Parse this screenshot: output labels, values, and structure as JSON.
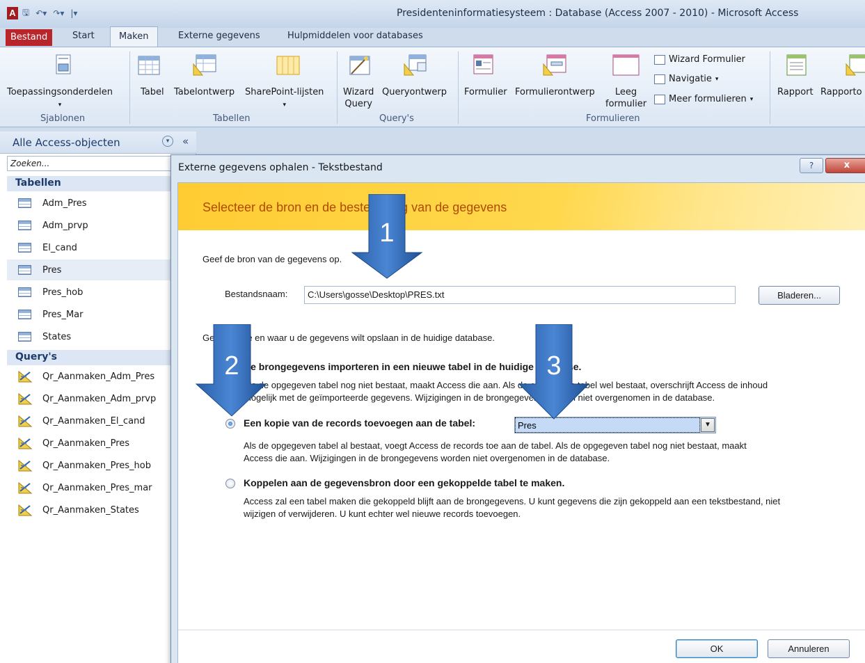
{
  "window": {
    "app_icon": "A",
    "title": "Presidenteninformatiesysteem : Database (Access 2007 - 2010)  -  Microsoft Access",
    "qat_icons": [
      "save-icon",
      "undo-icon",
      "redo-icon",
      "customize-qat-icon"
    ]
  },
  "ribbon": {
    "tabs": {
      "bestand": "Bestand",
      "start": "Start",
      "maken": "Maken",
      "externe": "Externe gegevens",
      "hulpmiddelen": "Hulpmiddelen voor databases"
    },
    "groups": {
      "sjablonen": {
        "label": "Sjablonen",
        "toepassingsonderdelen": "Toepassingsonderdelen"
      },
      "tabellen": {
        "label": "Tabellen",
        "tabel": "Tabel",
        "tabelontwerp": "Tabelontwerp",
        "sharepoint": "SharePoint-lijsten"
      },
      "querys": {
        "label": "Query's",
        "wizard_query_1": "Wizard",
        "wizard_query_2": "Query",
        "queryontwerp": "Queryontwerp"
      },
      "formulieren": {
        "label": "Formulieren",
        "formulier": "Formulier",
        "formulierontwerp": "Formulierontwerp",
        "leeg_1": "Leeg",
        "leeg_2": "formulier",
        "wizard_formulier": "Wizard Formulier",
        "navigatie": "Navigatie",
        "meer_formulieren": "Meer formulieren"
      },
      "rapporten": {
        "rapport": "Rapport",
        "rapportontwerp": "Rapporto"
      }
    }
  },
  "nav": {
    "title": "Alle Access-objecten",
    "search_placeholder": "Zoeken...",
    "tables_header": "Tabellen",
    "tables": [
      "Adm_Pres",
      "Adm_prvp",
      "El_cand",
      "Pres",
      "Pres_hob",
      "Pres_Mar",
      "States"
    ],
    "queries_header": "Query's",
    "queries": [
      "Qr_Aanmaken_Adm_Pres",
      "Qr_Aanmaken_Adm_prvp",
      "Qr_Aanmaken_El_cand",
      "Qr_Aanmaken_Pres",
      "Qr_Aanmaken_Pres_hob",
      "Qr_Aanmaken_Pres_mar",
      "Qr_Aanmaken_States"
    ]
  },
  "dialog": {
    "title": "Externe gegevens ophalen - Tekstbestand",
    "help": "?",
    "close": "x",
    "banner": "Selecteer de bron en de bestemming van de gegevens",
    "source_prompt": "Geef de bron van de gegevens op.",
    "filename_label": "Bestandsnaam:",
    "filename_value": "C:\\Users\\gosse\\Desktop\\PRES.txt",
    "browse": "Bladeren...",
    "storage_prompt": "Geef op hoe en waar u de gegevens wilt opslaan in de huidige database.",
    "option_import": {
      "title": "De brongegevens importeren in een nieuwe tabel in de huidige database.",
      "desc_1": "Als de opgegeven tabel nog niet bestaat, maakt Access die aan. Als de opgegeven tabel wel bestaat, overschrijft Access de inhoud",
      "desc_2": "mogelijk met de geïmporteerde gegevens. Wijzigingen in de brongegevens worden niet overgenomen in de database."
    },
    "option_append": {
      "title": "Een kopie van de records toevoegen aan de tabel:",
      "selected_table": "Pres",
      "desc_1": "Als de opgegeven tabel al bestaat, voegt Access de records toe aan de tabel. Als de opgegeven tabel nog niet bestaat, maakt",
      "desc_2": "Access die aan. Wijzigingen in de brongegevens worden niet overgenomen in de database."
    },
    "option_link": {
      "title": "Koppelen aan de gegevensbron door een gekoppelde tabel te maken.",
      "desc_1": "Access zal een tabel maken die gekoppeld blijft aan de brongegevens. U kunt gegevens die zijn gekoppeld aan een tekstbestand, niet",
      "desc_2": "wijzigen of verwijderen. U kunt echter wel nieuwe records toevoegen."
    },
    "ok": "OK",
    "cancel": "Annuleren"
  },
  "annotations": [
    "1",
    "2",
    "3"
  ],
  "colors": {
    "arrow_fill": "#2f69b8",
    "banner": "#ffcc33",
    "bestand_tab": "#b8262c"
  }
}
